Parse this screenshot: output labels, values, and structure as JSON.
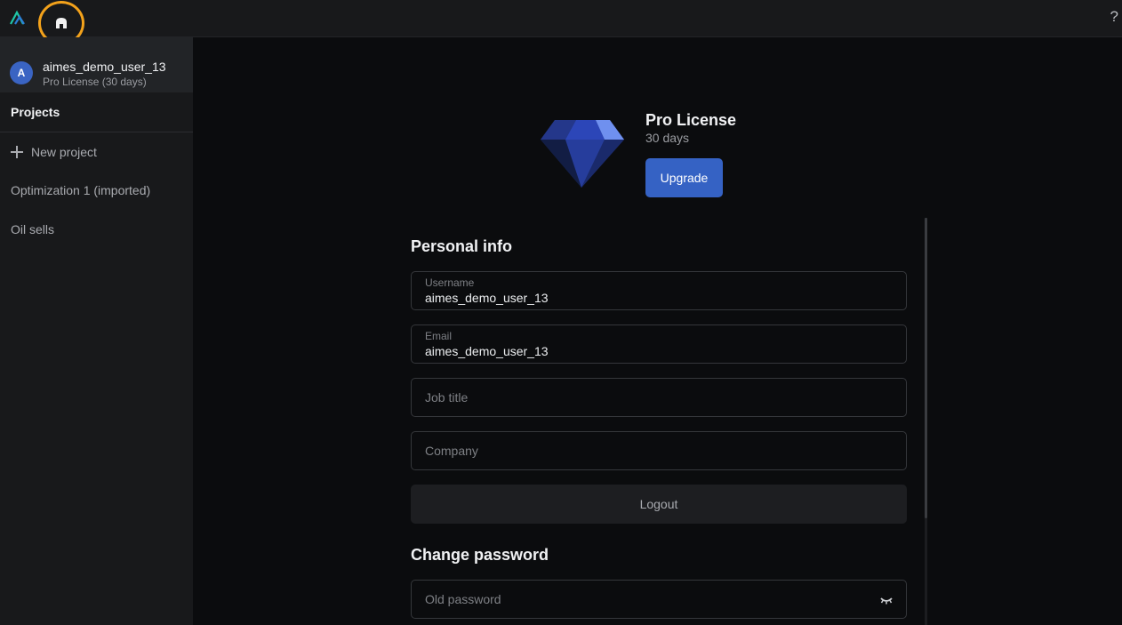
{
  "topbar": {
    "help_label": "?"
  },
  "sidebar": {
    "user": {
      "avatar_initial": "A",
      "name": "aimes_demo_user_13",
      "license": "Pro License (30 days)"
    },
    "projects_label": "Projects",
    "new_project_label": "New project",
    "projects": [
      {
        "label": "Optimization 1 (imported)"
      },
      {
        "label": "Oil sells"
      }
    ]
  },
  "license": {
    "title": "Pro License",
    "duration": "30 days",
    "upgrade_label": "Upgrade"
  },
  "personal_info": {
    "title": "Personal info",
    "username": {
      "label": "Username",
      "value": "aimes_demo_user_13"
    },
    "email": {
      "label": "Email",
      "value": "aimes_demo_user_13"
    },
    "job_title": {
      "placeholder": "Job title"
    },
    "company": {
      "placeholder": "Company"
    },
    "logout_label": "Logout"
  },
  "change_password": {
    "title": "Change password",
    "old_password": {
      "placeholder": "Old password"
    }
  },
  "colors": {
    "accent": "#3562c4",
    "highlight": "#f3a21b",
    "logo": "#1fc6a8"
  }
}
